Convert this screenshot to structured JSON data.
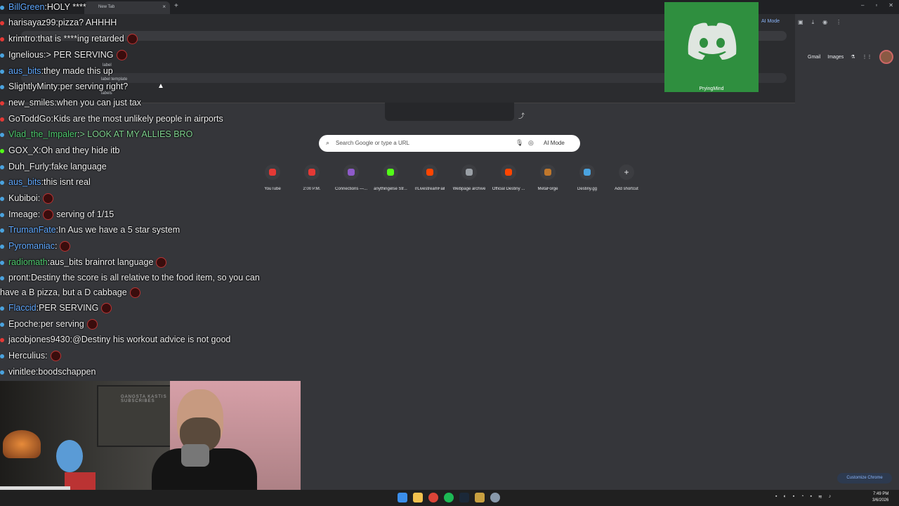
{
  "browser": {
    "tab_title": "New Tab",
    "new_tab_icon": "+",
    "ai_mode_top": "AI Mode",
    "links": [
      "Gmail",
      "Images"
    ],
    "search_placeholder": "Search Google or type a URL",
    "ai_mode_label": "AI Mode",
    "customize_label": "Customize Chrome",
    "fragments": [
      "label",
      "label template",
      "labels"
    ]
  },
  "shortcuts": [
    {
      "label": "YouTube",
      "color": "#e53935"
    },
    {
      "label": "2:00 P.M.",
      "color": "#e53935"
    },
    {
      "label": "Connections —...",
      "color": "#8e5ac9"
    },
    {
      "label": "anythingelse Str...",
      "color": "#53fc18"
    },
    {
      "label": "r/LivestreamFail",
      "color": "#ff4500"
    },
    {
      "label": "Webpage archive",
      "color": "#9aa0a6"
    },
    {
      "label": "Official Destiny ...",
      "color": "#ff4500"
    },
    {
      "label": "MetaForge",
      "color": "#c0772c"
    },
    {
      "label": "Destiny.gg",
      "color": "#4aa3df"
    },
    {
      "label": "Add shortcut",
      "color": "#3c3d41"
    }
  ],
  "discord": {
    "name": "PryingMind"
  },
  "chat": [
    {
      "user": "BillGreen",
      "text": "HOLY ****",
      "color": "#5fa8ff",
      "badge": "#4aa3df"
    },
    {
      "user": "harisayaz99",
      "text": "pizza? AHHHH",
      "color": "#efefef",
      "badge": "#e53935"
    },
    {
      "user": "krimtro",
      "text": "that is ****ing retarded",
      "color": "#efefef",
      "badge": "#e53935",
      "emote": true
    },
    {
      "user": "Ignelious",
      "text": "> PER SERVING",
      "color": "#efefef",
      "badge": "#4aa3df",
      "emote": true
    },
    {
      "user": "aus_bits",
      "text": "they made this up",
      "color": "#5fa8ff",
      "badge": "#4aa3df"
    },
    {
      "user": "SlightlyMinty",
      "text": "per serving right?",
      "color": "#efefef",
      "badge": "#4aa3df"
    },
    {
      "user": "new_smiles",
      "text": "when you can just tax",
      "color": "#efefef",
      "badge": "#e53935"
    },
    {
      "user": "GoToddGo",
      "text": "Kids are the most unlikely people in airports",
      "color": "#efefef",
      "badge": "#e53935"
    },
    {
      "user": "Vlad_the_Impaler",
      "text": "> LOOK AT MY ALLIES BRO",
      "color": "#4ecb6e",
      "badge": "#4aa3df",
      "textcolor": "#7fd38f"
    },
    {
      "user": "GOX_X",
      "text": "Oh and they hide itb",
      "color": "#efefef",
      "badge": "#53fc18"
    },
    {
      "user": "Duh_Furly",
      "text": "fake language",
      "color": "#efefef",
      "badge": "#4aa3df"
    },
    {
      "user": "aus_bits",
      "text": "this isnt real",
      "color": "#5fa8ff",
      "badge": "#4aa3df"
    },
    {
      "user": "Kubiboi",
      "text": "",
      "color": "#efefef",
      "badge": "#4aa3df",
      "emote": true
    },
    {
      "user": "Imeage",
      "text": "serving of 1/15",
      "color": "#efefef",
      "badge": "#4aa3df",
      "emote": true,
      "emote_first": true
    },
    {
      "user": "TrumanFate",
      "text": "In Aus we have a 5 star system",
      "color": "#5fa8ff",
      "badge": "#4aa3df"
    },
    {
      "user": "Pyromaniac",
      "text": "",
      "color": "#5fa8ff",
      "badge": "#4aa3df",
      "emote": true
    },
    {
      "user": "radiomath",
      "text": "aus_bits brainrot language",
      "color": "#4ecb6e",
      "badge": "#4aa3df",
      "emote": true
    },
    {
      "user": "pront",
      "text": "Destiny the score is all relative to the food item, so you can",
      "color": "#efefef",
      "badge": "#4aa3df"
    },
    {
      "user": "",
      "text": "have a B pizza, but a D cabbage",
      "color": "#efefef",
      "badge": "",
      "emote": true,
      "continuation": true
    },
    {
      "user": "Flaccid",
      "text": "PER SERVING",
      "color": "#5fa8ff",
      "badge": "#4aa3df",
      "emote": true
    },
    {
      "user": "Epoche",
      "text": "per serving",
      "color": "#efefef",
      "badge": "#4aa3df",
      "emote": true
    },
    {
      "user": "jacobjones9430",
      "text": "@Destiny his workout advice is not good",
      "color": "#efefef",
      "badge": "#e53935"
    },
    {
      "user": "Herculius",
      "text": "",
      "color": "#efefef",
      "badge": "#4aa3df",
      "emote": true
    },
    {
      "user": "vinitlee",
      "text": "boodschappen",
      "color": "#efefef",
      "badge": "#4aa3df"
    }
  ],
  "webcam": {
    "poster_text": "GANGSTA KASTIS SUBSCRIBES"
  },
  "clock": {
    "time": "7:49 PM",
    "date": "3/6/2026"
  }
}
